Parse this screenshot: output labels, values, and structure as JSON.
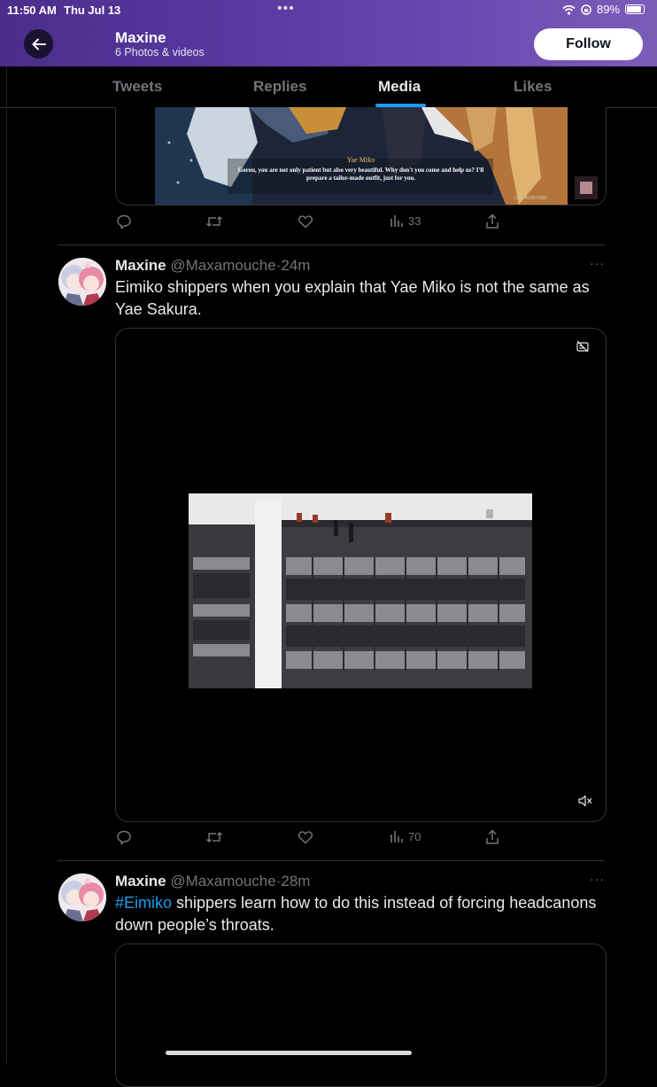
{
  "status_bar": {
    "time": "11:50 AM",
    "date": "Thu Jul 13",
    "dots": "•••",
    "battery": "89%",
    "battery_level": 0.89
  },
  "header": {
    "name": "Maxine",
    "subtitle": "6 Photos & videos",
    "follow_label": "Follow"
  },
  "tabs": [
    {
      "label": "Tweets",
      "active": false
    },
    {
      "label": "Replies",
      "active": false
    },
    {
      "label": "Media",
      "active": true
    },
    {
      "label": "Likes",
      "active": false
    }
  ],
  "tweets": [
    {
      "media": {
        "speaker": "Yae Miko",
        "subtitle": "Gorou, you are not only patient but also very beautiful. Why don't you come and help us? I'll prepare a tailor-made outfit, just for you.",
        "uid": "UID: 802976583"
      },
      "views": "33"
    },
    {
      "name": "Maxine",
      "handle": "@Maxamouche",
      "time": "24m",
      "text": "Eimiko shippers when you explain that Yae Miko is not the same as Yae Sakura.",
      "views": "70"
    },
    {
      "name": "Maxine",
      "handle": "@Maxamouche",
      "time": "28m",
      "hashtag": "#Eimiko",
      "text": " shippers learn how to do this instead of forcing headcanons down people’s throats."
    }
  ],
  "sep": "·",
  "more": "···"
}
